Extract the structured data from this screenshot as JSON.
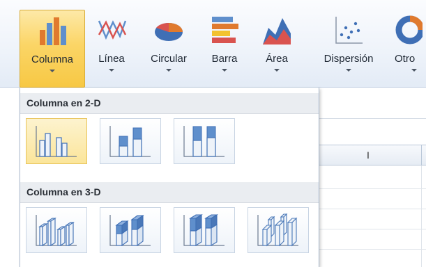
{
  "ribbon": {
    "buttons": [
      {
        "label": "Columna"
      },
      {
        "label": "Línea"
      },
      {
        "label": "Circular"
      },
      {
        "label": "Barra"
      },
      {
        "label": "Área"
      },
      {
        "label": "Dispersión"
      },
      {
        "label": "Otro"
      }
    ]
  },
  "gallery": {
    "section_2d": {
      "title": "Columna en 2-D",
      "items": [
        "clustered-column-icon",
        "stacked-column-icon",
        "100-stacked-column-icon"
      ]
    },
    "section_3d": {
      "title": "Columna en 3-D",
      "items": [
        "3d-clustered-column-icon",
        "3d-stacked-column-icon",
        "3d-100-stacked-column-icon",
        "3d-column-icon"
      ]
    }
  },
  "sheet": {
    "column_header": "I"
  },
  "colors": {
    "active_button": "#fbd566",
    "bar_blue": "#5f8fcc",
    "bar_orange": "#e07a2e"
  }
}
